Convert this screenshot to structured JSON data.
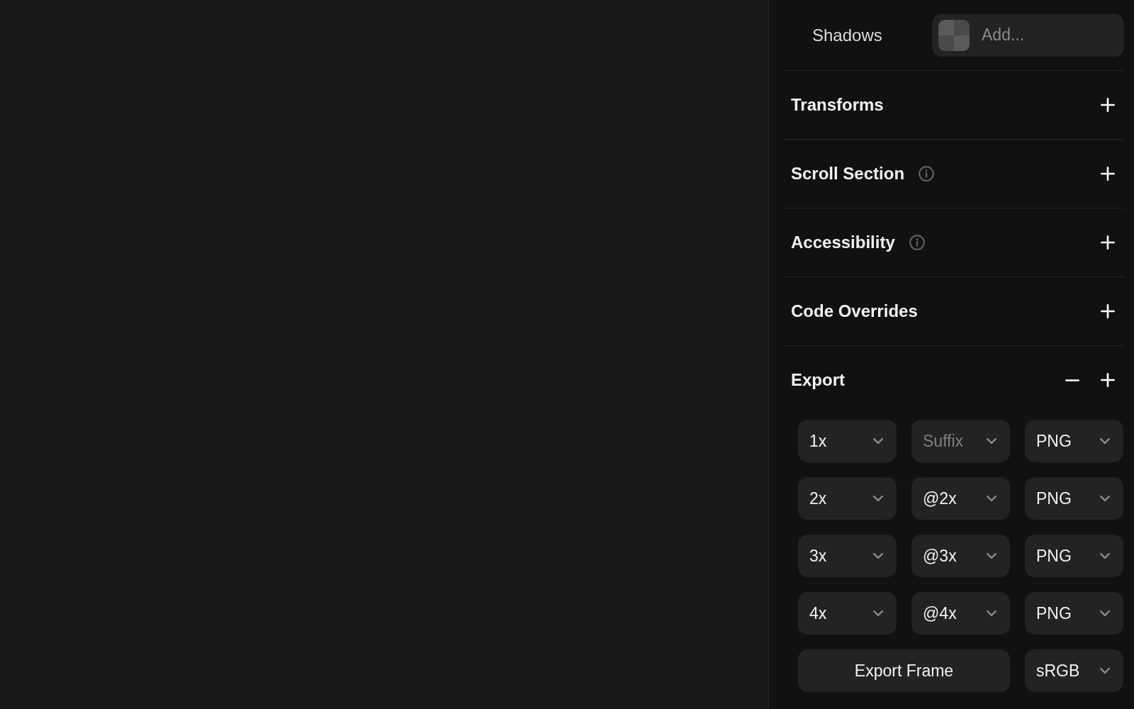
{
  "shadows": {
    "label": "Shadows",
    "placeholder": "Add..."
  },
  "sections": [
    {
      "title": "Transforms",
      "info": false
    },
    {
      "title": "Scroll Section",
      "info": true
    },
    {
      "title": "Accessibility",
      "info": true
    },
    {
      "title": "Code Overrides",
      "info": false
    }
  ],
  "export": {
    "title": "Export",
    "presets": [
      {
        "scale": "1x",
        "suffix": {
          "placeholder": "Suffix"
        },
        "format": "PNG"
      },
      {
        "scale": "2x",
        "suffix": {
          "value": "@2x"
        },
        "format": "PNG"
      },
      {
        "scale": "3x",
        "suffix": {
          "value": "@3x"
        },
        "format": "PNG"
      },
      {
        "scale": "4x",
        "suffix": {
          "value": "@4x"
        },
        "format": "PNG"
      }
    ],
    "export_button": "Export Frame",
    "color_profile": "sRGB"
  }
}
